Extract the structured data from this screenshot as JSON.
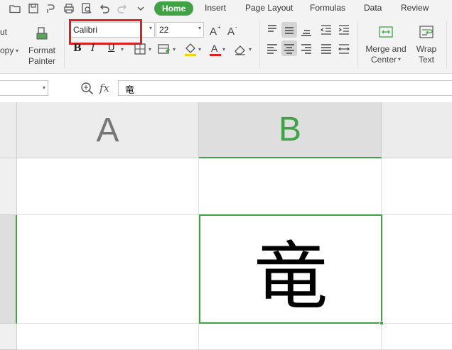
{
  "tabs": [
    {
      "label": "Home",
      "active": true
    },
    {
      "label": "Insert"
    },
    {
      "label": "Page Layout"
    },
    {
      "label": "Formulas"
    },
    {
      "label": "Data"
    },
    {
      "label": "Review"
    }
  ],
  "ribbon": {
    "cut_label": "ut",
    "copy_label": "opy",
    "format_painter_label1": "Format",
    "format_painter_label2": "Painter",
    "font_name": "Calibri",
    "font_size": "22",
    "bold": "B",
    "italic": "I",
    "underline": "U",
    "merge_label1": "Merge and",
    "merge_label2": "Center",
    "wrap_label1": "Wrap",
    "wrap_label2": "Text"
  },
  "formula_bar": {
    "fx_label": "fx",
    "value": "竜"
  },
  "grid": {
    "columns": [
      "A",
      "B"
    ],
    "selected_column": "B",
    "active_cell_value": "竜"
  },
  "colors": {
    "accent": "#3fa346",
    "highlight": "#e02020"
  }
}
